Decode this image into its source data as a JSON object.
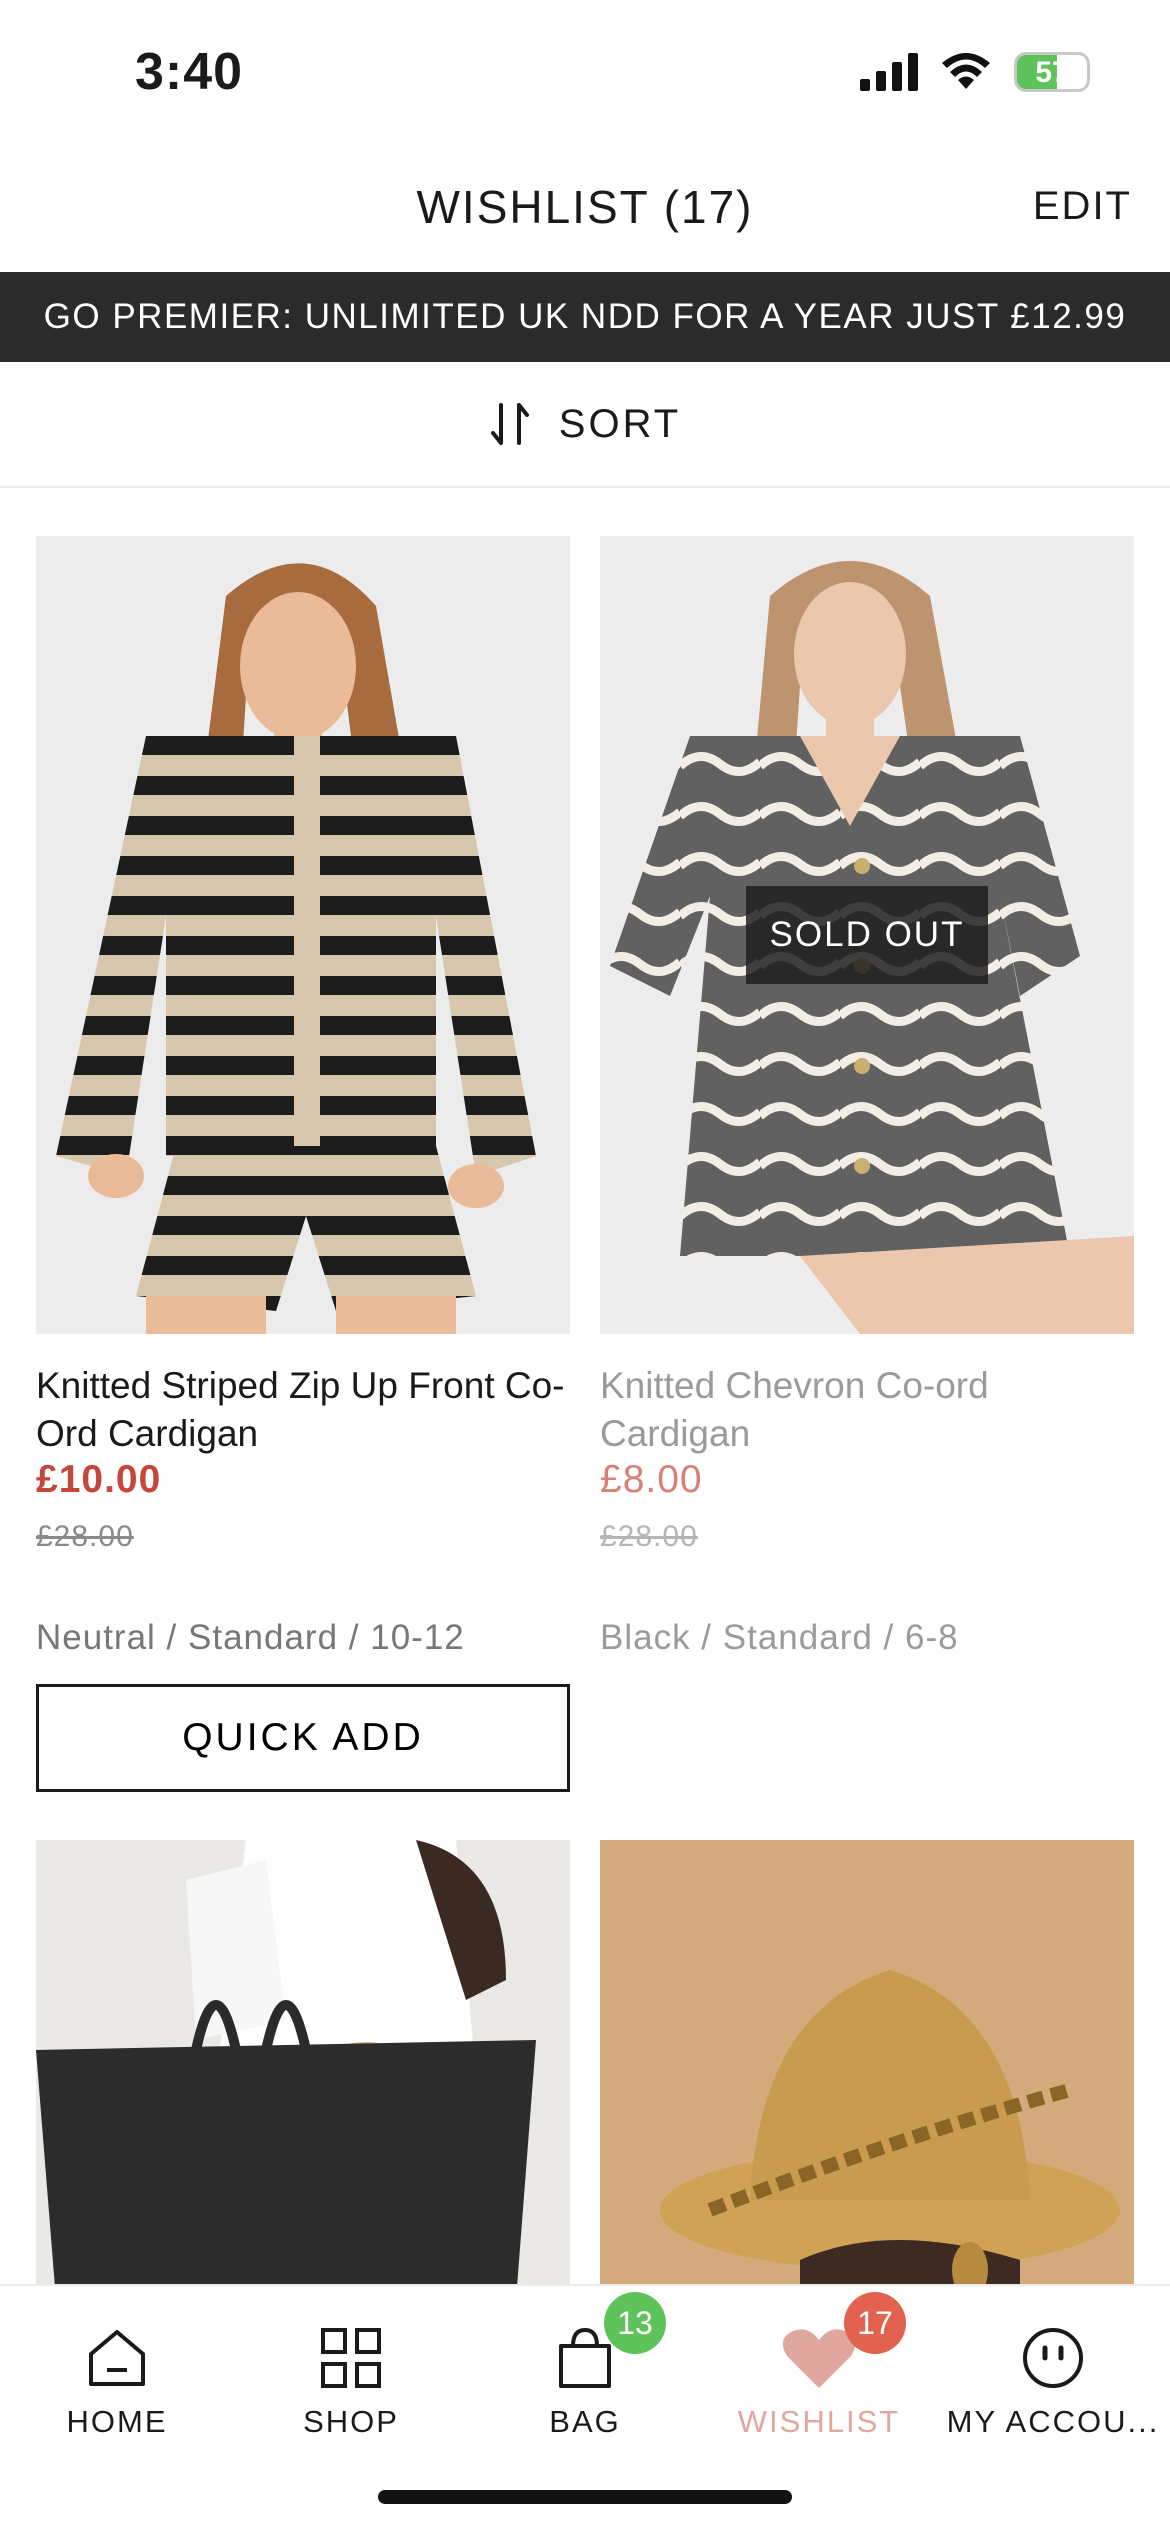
{
  "status_bar": {
    "time": "3:40",
    "battery": "57",
    "battery_level": 0.57
  },
  "header": {
    "title": "WISHLIST (17)",
    "edit_label": "EDIT"
  },
  "promo": {
    "text": "GO PREMIER: UNLIMITED UK NDD FOR A YEAR JUST £12.99"
  },
  "sort": {
    "label": "SORT"
  },
  "products": [
    {
      "name": "Knitted Striped Zip Up Front Co-Ord Cardigan",
      "price": "£10.00",
      "was_price": "£28.00",
      "variant": "Neutral / Standard / 10-12",
      "action": "QUICK ADD"
    },
    {
      "name": "Knitted Chevron Co-ord Cardigan",
      "price": "£8.00",
      "was_price": "£28.00",
      "variant": "Black / Standard / 6-8",
      "badge": "SOLD OUT"
    }
  ],
  "bottom_nav": {
    "items": [
      {
        "label": "HOME",
        "icon": "home-icon"
      },
      {
        "label": "SHOP",
        "icon": "grid-icon"
      },
      {
        "label": "BAG",
        "icon": "bag-icon",
        "badge": "13"
      },
      {
        "label": "WISHLIST",
        "icon": "heart-icon",
        "badge": "17"
      },
      {
        "label": "MY ACCOU...",
        "icon": "account-icon"
      }
    ]
  },
  "colors": {
    "sale_price": "#c4473c",
    "promo_bg": "#2b2b2b",
    "bag_badge": "#5ec35a",
    "wishlist_badge": "#e2614f",
    "wishlist_active": "#e0a79f"
  }
}
